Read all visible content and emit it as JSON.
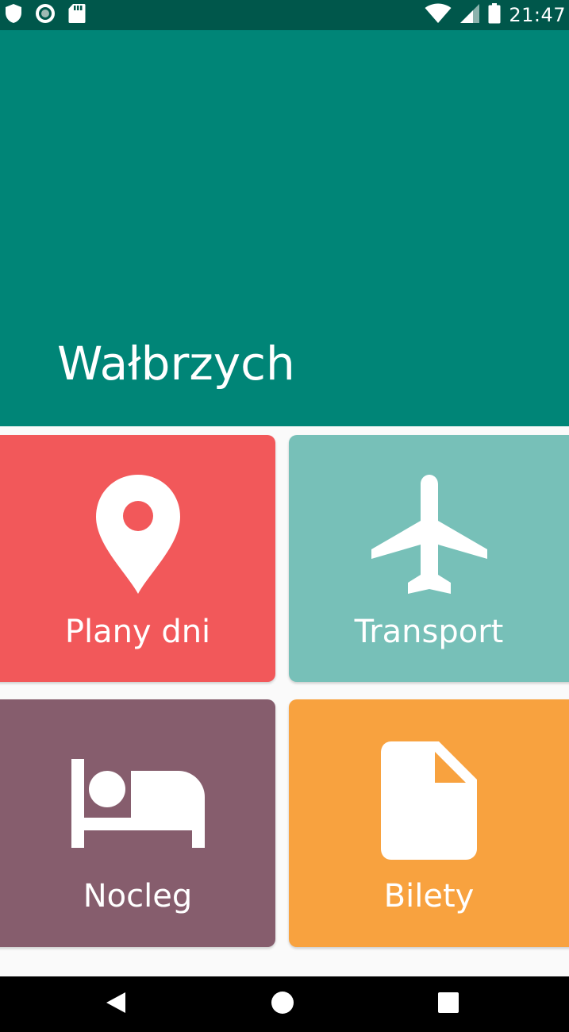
{
  "status_bar": {
    "time": "21:47",
    "left_icons": [
      "shield-icon",
      "record-icon",
      "sd-card-icon"
    ],
    "right_icons": [
      "wifi-icon",
      "signal-icon",
      "battery-icon"
    ]
  },
  "header": {
    "title": "Wałbrzych",
    "background_color": "#008577"
  },
  "tiles": [
    {
      "label": "Plany dni",
      "icon": "location-pin-icon",
      "color": "#f2585a"
    },
    {
      "label": "Transport",
      "icon": "airplane-icon",
      "color": "#77c0b8"
    },
    {
      "label": "Nocleg",
      "icon": "bed-icon",
      "color": "#865d6d"
    },
    {
      "label": "Bilety",
      "icon": "document-icon",
      "color": "#f8a23f"
    }
  ],
  "nav_bar": {
    "buttons": [
      "back-icon",
      "home-icon",
      "recents-icon"
    ]
  }
}
